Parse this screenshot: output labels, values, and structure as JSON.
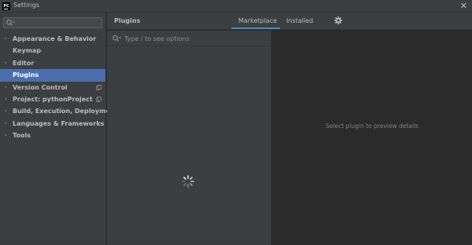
{
  "window": {
    "logo_text": "PC",
    "title": "Settings",
    "close_glyph": "✕"
  },
  "sidebar": {
    "search_placeholder": "",
    "items": [
      {
        "label": "Appearance & Behavior",
        "expandable": true,
        "selected": false,
        "project_icon": false
      },
      {
        "label": "Keymap",
        "expandable": false,
        "selected": false,
        "project_icon": false
      },
      {
        "label": "Editor",
        "expandable": true,
        "selected": false,
        "project_icon": false
      },
      {
        "label": "Plugins",
        "expandable": false,
        "selected": true,
        "project_icon": false
      },
      {
        "label": "Version Control",
        "expandable": true,
        "selected": false,
        "project_icon": true
      },
      {
        "label": "Project: pythonProject",
        "expandable": true,
        "selected": false,
        "project_icon": true
      },
      {
        "label": "Build, Execution, Deployment",
        "expandable": true,
        "selected": false,
        "project_icon": false
      },
      {
        "label": "Languages & Frameworks",
        "expandable": true,
        "selected": false,
        "project_icon": false
      },
      {
        "label": "Tools",
        "expandable": true,
        "selected": false,
        "project_icon": false
      }
    ]
  },
  "header": {
    "title": "Plugins",
    "tabs": [
      {
        "label": "Marketplace",
        "active": true
      },
      {
        "label": "Installed",
        "active": false
      }
    ],
    "settings_icon": "gear-icon"
  },
  "plugin_list": {
    "search_placeholder": "Type / to see options",
    "loading": true
  },
  "details": {
    "empty_text": "Select plugin to preview details"
  },
  "colors": {
    "selection": "#4b6eaf",
    "tab_underline": "#4a88c7",
    "panel": "#3c3f41",
    "background": "#2b2b2b"
  }
}
